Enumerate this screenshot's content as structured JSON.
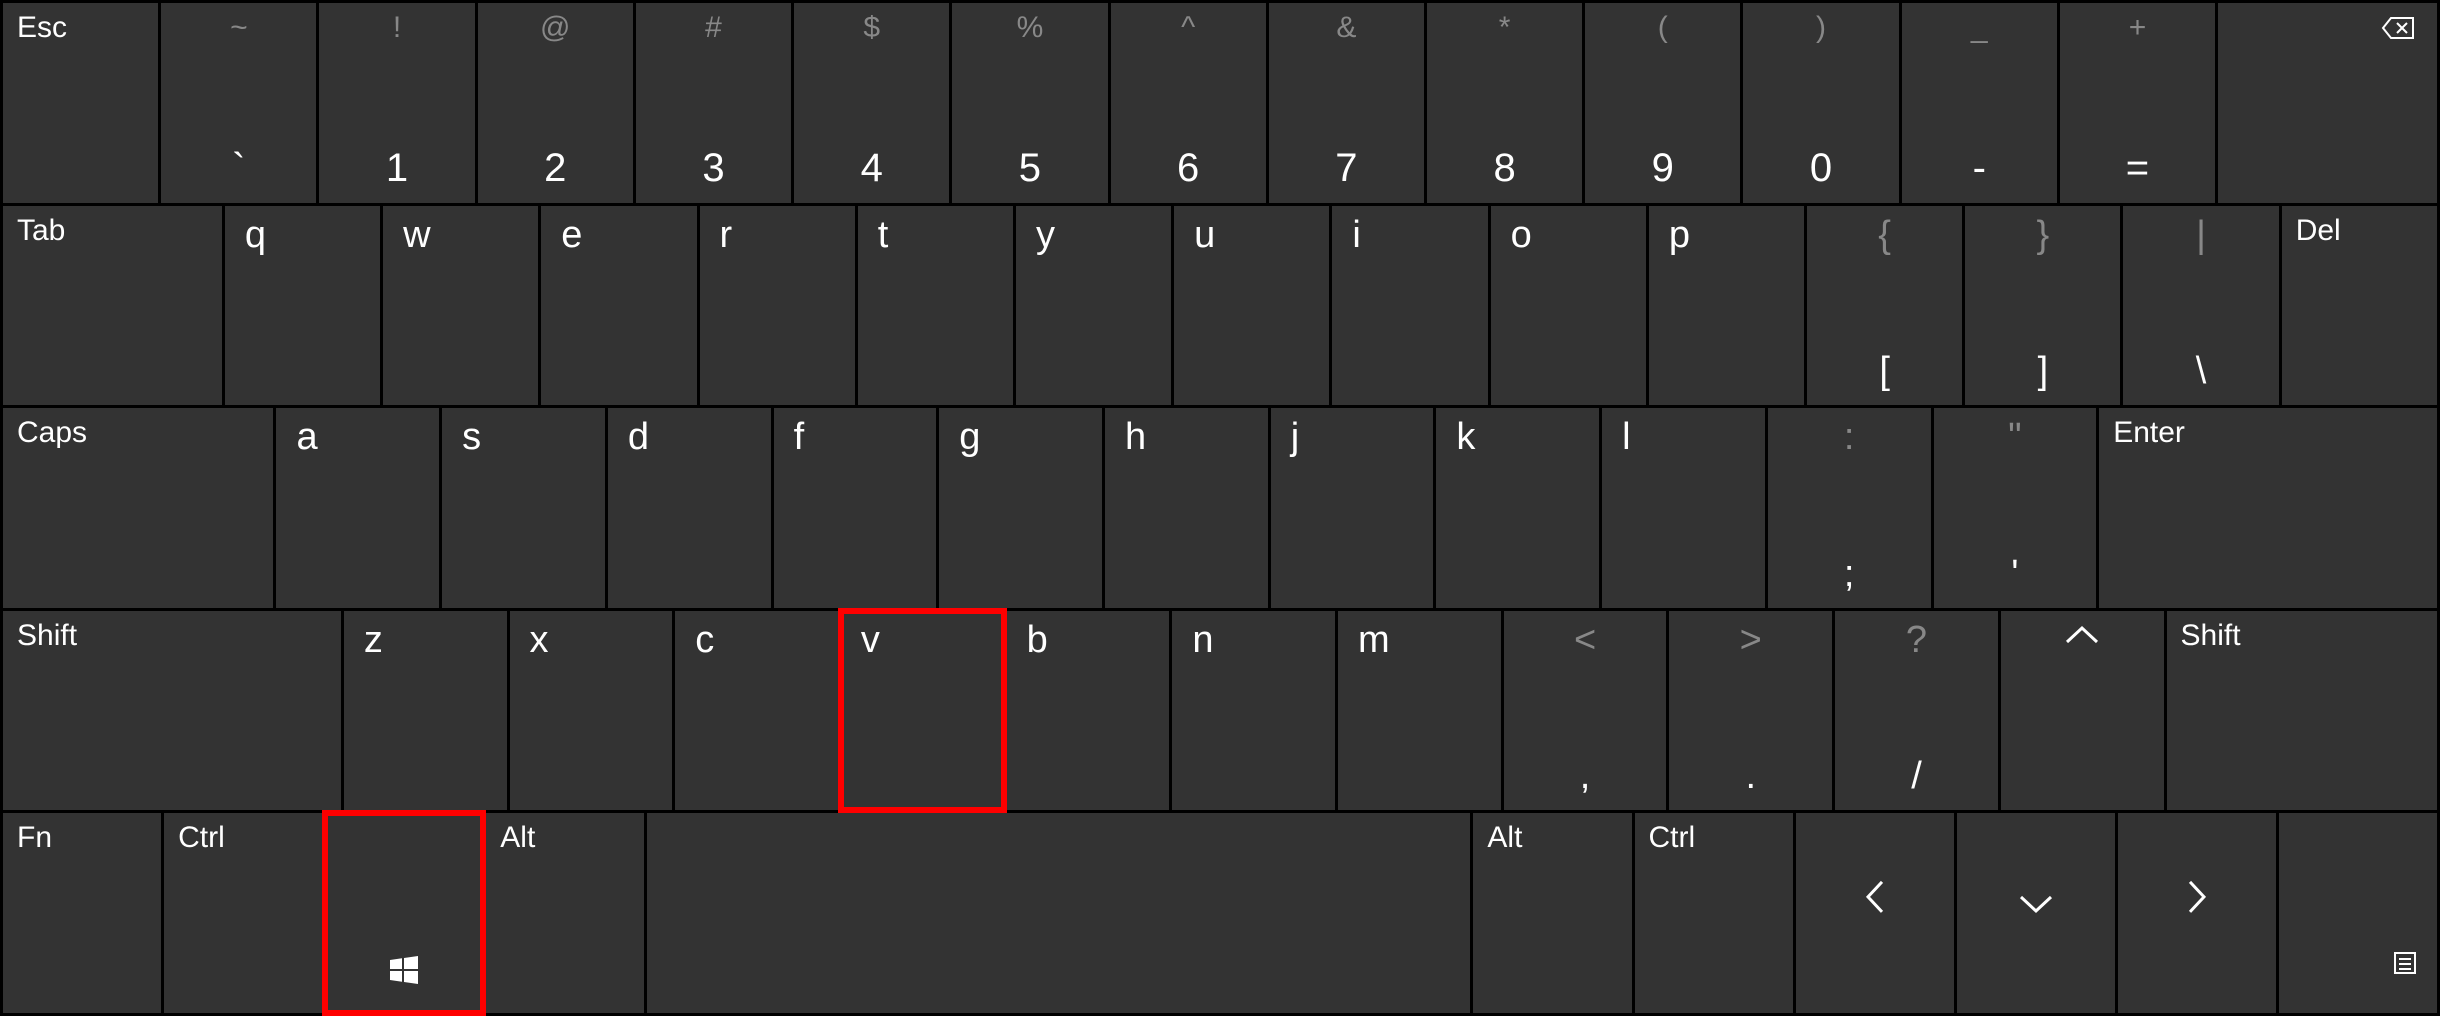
{
  "row1": {
    "esc": "Esc",
    "keys": [
      {
        "upper": "~",
        "lower": "`"
      },
      {
        "upper": "!",
        "lower": "1"
      },
      {
        "upper": "@",
        "lower": "2"
      },
      {
        "upper": "#",
        "lower": "3"
      },
      {
        "upper": "$",
        "lower": "4"
      },
      {
        "upper": "%",
        "lower": "5"
      },
      {
        "upper": "^",
        "lower": "6"
      },
      {
        "upper": "&",
        "lower": "7"
      },
      {
        "upper": "*",
        "lower": "8"
      },
      {
        "upper": "(",
        "lower": "9"
      },
      {
        "upper": ")",
        "lower": "0"
      },
      {
        "upper": "_",
        "lower": "-"
      },
      {
        "upper": "+",
        "lower": "="
      }
    ]
  },
  "row2": {
    "tab": "Tab",
    "letters": [
      "q",
      "w",
      "e",
      "r",
      "t",
      "y",
      "u",
      "i",
      "o",
      "p"
    ],
    "brackets": [
      {
        "upper": "{",
        "lower": "["
      },
      {
        "upper": "}",
        "lower": "]"
      },
      {
        "upper": "|",
        "lower": "\\"
      }
    ],
    "del": "Del"
  },
  "row3": {
    "caps": "Caps",
    "letters": [
      "a",
      "s",
      "d",
      "f",
      "g",
      "h",
      "j",
      "k",
      "l"
    ],
    "punct": [
      {
        "upper": ":",
        "lower": ";"
      },
      {
        "upper": "\"",
        "lower": "'"
      }
    ],
    "enter": "Enter"
  },
  "row4": {
    "shift_left": "Shift",
    "letters": [
      "z",
      "x",
      "c",
      "v",
      "b",
      "n",
      "m"
    ],
    "punct": [
      {
        "upper": "<",
        "lower": ","
      },
      {
        "upper": ">",
        "lower": "."
      },
      {
        "upper": "?",
        "lower": "/"
      }
    ],
    "shift_right": "Shift"
  },
  "row5": {
    "fn": "Fn",
    "ctrl_left": "Ctrl",
    "alt_left": "Alt",
    "alt_right": "Alt",
    "ctrl_right": "Ctrl"
  },
  "highlighted_keys": [
    "v",
    "win"
  ],
  "colors": {
    "key_bg": "#333333",
    "text": "#ffffff",
    "dim_text": "#888888",
    "highlight": "#ff0000"
  }
}
